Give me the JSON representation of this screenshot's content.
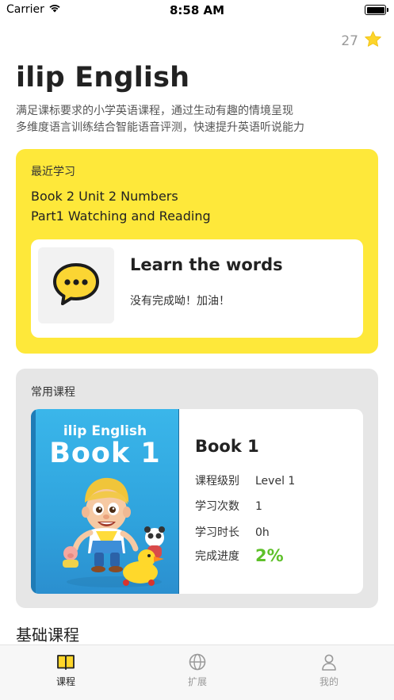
{
  "status_bar": {
    "carrier": "Carrier",
    "time": "8:58 AM"
  },
  "stars": {
    "count": "27",
    "icon": "star-icon",
    "color": "#fdd52b"
  },
  "header": {
    "title": "ilip English",
    "subtitle_line1": "满足课标要求的小学英语课程，通过生动有趣的情境呈现",
    "subtitle_line2": "多维度语言训练结合智能语音评测，快速提升英语听说能力"
  },
  "recent": {
    "heading": "最近学习",
    "book_unit": "Book 2 Unit 2 Numbers",
    "part": "Part1 Watching and Reading",
    "accent_color": "#fee83a",
    "lesson": {
      "icon": "chat-bubble-icon",
      "title": "Learn the words",
      "status": "没有完成呦！加油！"
    }
  },
  "courses": {
    "heading": "常用课程",
    "item": {
      "cover_brand": "ilip English",
      "cover_title": "Book 1",
      "name": "Book 1",
      "level_label": "课程级别",
      "level_value": "Level 1",
      "count_label": "学习次数",
      "count_value": "1",
      "duration_label": "学习时长",
      "duration_value": "0h",
      "progress_label": "完成进度",
      "progress_value": "2%",
      "progress_color": "#5ec02a"
    }
  },
  "basic_section": {
    "title": "基础课程"
  },
  "tab_bar": {
    "tabs": [
      {
        "label": "课程",
        "icon": "book-icon",
        "active": true
      },
      {
        "label": "扩展",
        "icon": "globe-icon",
        "active": false
      },
      {
        "label": "我的",
        "icon": "person-icon",
        "active": false
      }
    ]
  }
}
